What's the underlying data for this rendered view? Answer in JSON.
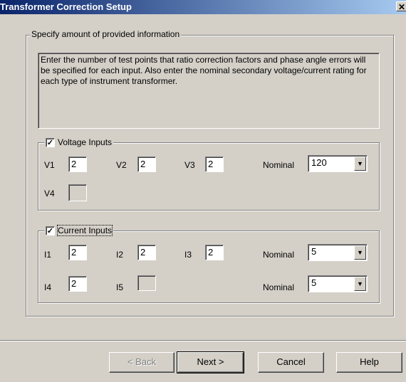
{
  "window": {
    "title": "Transformer Correction Setup",
    "close_glyph": "✕"
  },
  "main_group": {
    "legend": "Specify amount of provided information",
    "info_text": "Enter the number of test points that ratio correction factors and phase angle errors will be specified for each input.  Also enter the nominal secondary voltage/current rating for each type of instrument transformer."
  },
  "voltage": {
    "legend": "Voltage Inputs",
    "checked": true,
    "check_glyph": "✓",
    "labels": {
      "v1": "V1",
      "v2": "V2",
      "v3": "V3",
      "v4": "V4"
    },
    "values": {
      "v1": "2",
      "v2": "2",
      "v3": "2",
      "v4": ""
    },
    "nominal_label": "Nominal",
    "nominal_value": "120"
  },
  "current": {
    "legend": "Current Inputs",
    "checked": true,
    "check_glyph": "✓",
    "labels": {
      "i1": "I1",
      "i2": "I2",
      "i3": "I3",
      "i4": "I4",
      "i5": "I5"
    },
    "values": {
      "i1": "2",
      "i2": "2",
      "i3": "2",
      "i4": "2",
      "i5": ""
    },
    "nominal1_label": "Nominal",
    "nominal1_value": "5",
    "nominal2_label": "Nominal",
    "nominal2_value": "5"
  },
  "buttons": {
    "back": "< Back",
    "next": "Next >",
    "cancel": "Cancel",
    "help": "Help"
  },
  "icons": {
    "dropdown": "▼"
  }
}
